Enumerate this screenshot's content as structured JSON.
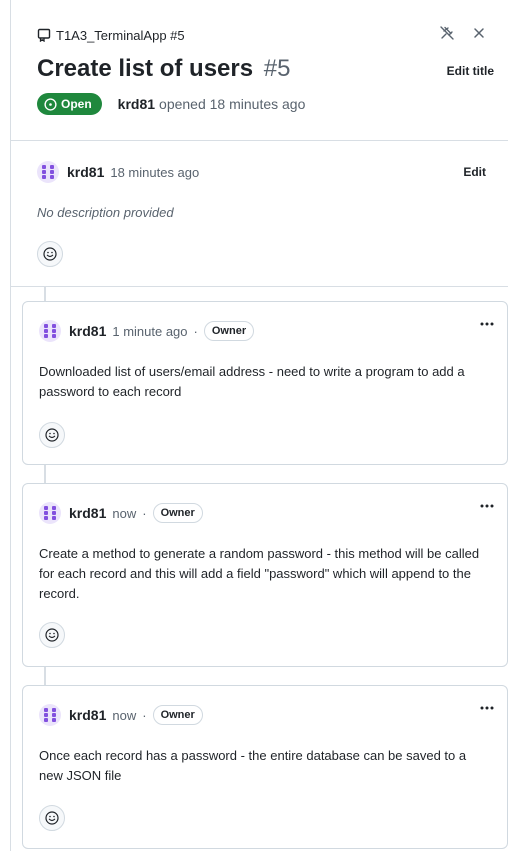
{
  "header": {
    "repo_ref": "T1A3_TerminalApp #5",
    "title": "Create list of users",
    "number": "#5",
    "edit_title_label": "Edit title",
    "status": "Open",
    "author": "krd81",
    "opened_text": "opened 18 minutes ago"
  },
  "description": {
    "author": "krd81",
    "time": "18 minutes ago",
    "edit_label": "Edit",
    "body": "No description provided"
  },
  "comments": [
    {
      "author": "krd81",
      "time": "1 minute ago",
      "role": "Owner",
      "body": "Downloaded list of users/email address - need to write a program to add a password to each record"
    },
    {
      "author": "krd81",
      "time": "now",
      "role": "Owner",
      "body": "Create a method to generate a random password - this method will be called for each record and this will add a field \"password\" which will append to the record."
    },
    {
      "author": "krd81",
      "time": "now",
      "role": "Owner",
      "body": "Once each record has a password - the entire database can be saved to a new JSON file"
    }
  ],
  "colors": {
    "open_green": "#1f883d",
    "avatar_purple": "#8250df",
    "border": "#d1d9e0",
    "muted_text": "#59636e"
  },
  "icons": {
    "repo": "issue-repo-icon",
    "unpin": "unpin-icon",
    "close": "close-icon",
    "status": "issue-open-icon",
    "reaction": "smiley-icon",
    "more": "kebab-horizontal-icon"
  }
}
